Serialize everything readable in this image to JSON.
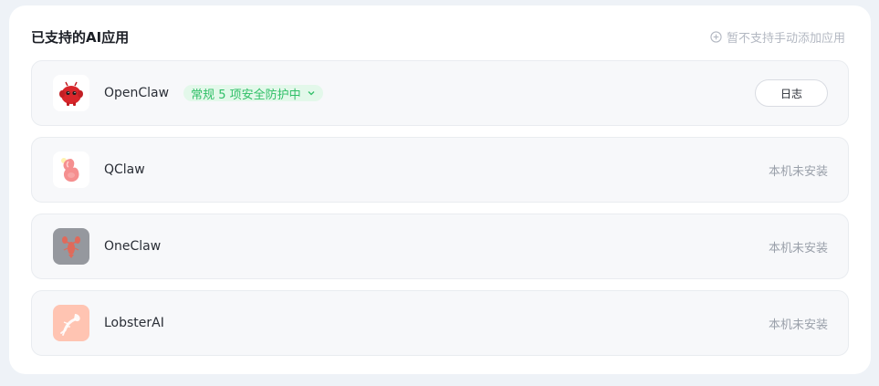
{
  "panel": {
    "title": "已支持的AI应用",
    "add_link": "暂不支持手动添加应用"
  },
  "apps": [
    {
      "name": "OpenClaw",
      "status_tag": "常规 5 项安全防护中",
      "action_label": "日志",
      "icon": "red-mascot-icon"
    },
    {
      "name": "QClaw",
      "status": "本机未安装",
      "icon": "pink-claw-icon"
    },
    {
      "name": "OneClaw",
      "status": "本机未安装",
      "icon": "gray-lobster-icon"
    },
    {
      "name": "LobsterAI",
      "status": "本机未安装",
      "icon": "peach-lobster-icon"
    }
  ],
  "colors": {
    "accent_green": "#2fbf67",
    "tag_bg": "#e3f8ea",
    "mascot_red": "#d8262b"
  }
}
